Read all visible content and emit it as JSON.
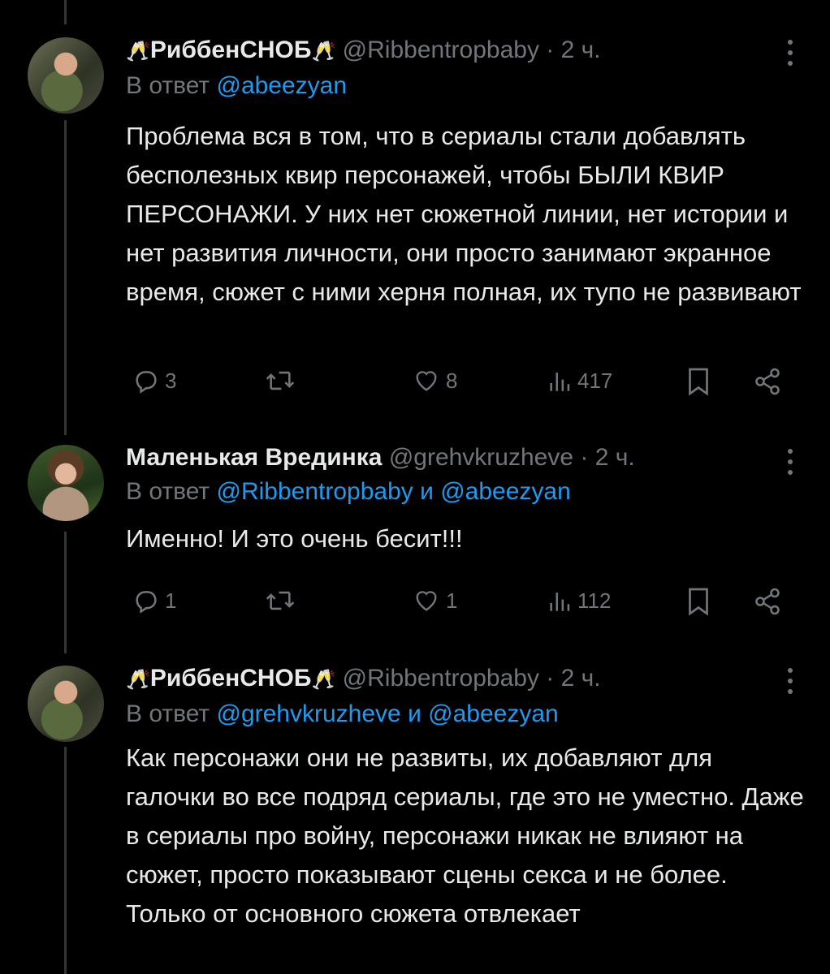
{
  "tweets": [
    {
      "display_name": "РиббенСНОБ",
      "emoji_left": "🥂",
      "emoji_right": "🥂",
      "handle": "@Ribbentropbaby",
      "separator": "·",
      "time": "2 ч.",
      "reply_prefix": "В ответ",
      "reply_mentions": [
        "@abeezyan"
      ],
      "reply_joiner": "",
      "text": "Проблема вся в том, что в сериалы стали добавлять бесполезных квир персонажей, чтобы БЫЛИ КВИР ПЕРСОНАЖИ. У них нет сюжетной линии, нет истории и нет развития личности, они просто занимают экранное время, сюжет с ними херня полная, их тупо не развивают",
      "replies": "3",
      "retweets": "",
      "likes": "8",
      "views": "417"
    },
    {
      "display_name": "Маленькая Врединка",
      "emoji_left": "",
      "emoji_right": "",
      "handle": "@grehvkruzheve",
      "separator": "·",
      "time": "2 ч.",
      "reply_prefix": "В ответ",
      "reply_mentions": [
        "@Ribbentropbaby",
        "@abeezyan"
      ],
      "reply_joiner": "и",
      "text": "Именно! И это очень бесит!!!",
      "replies": "1",
      "retweets": "",
      "likes": "1",
      "views": "112"
    },
    {
      "display_name": "РиббенСНОБ",
      "emoji_left": "🥂",
      "emoji_right": "🥂",
      "handle": "@Ribbentropbaby",
      "separator": "·",
      "time": "2 ч.",
      "reply_prefix": "В ответ",
      "reply_mentions": [
        "@grehvkruzheve",
        "@abeezyan"
      ],
      "reply_joiner": "и",
      "text": "Как персонажи они не развиты, их добавляют для галочки во все подряд сериалы, где это не уместно. Даже в сериалы про войну, персонажи никак не влияют на сюжет, просто показывают сцены секса и не более. Только от основного сюжета отвлекает"
    }
  ],
  "icons": {
    "reply": "reply-icon",
    "retweet": "retweet-icon",
    "like": "heart-icon",
    "views": "views-icon",
    "bookmark": "bookmark-icon",
    "share": "share-icon",
    "more": "more-icon"
  },
  "colors": {
    "background": "#000000",
    "text": "#e7e9ea",
    "secondary": "#71767b",
    "link": "#1d9bf0",
    "thread_line": "#333639"
  }
}
